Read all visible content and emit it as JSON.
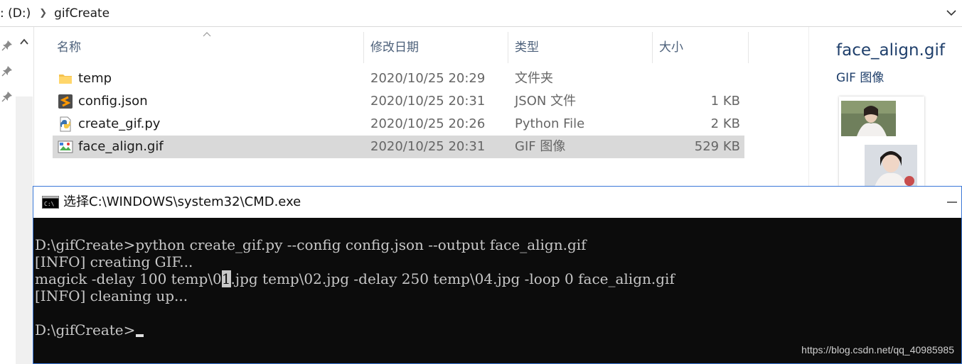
{
  "explorer": {
    "breadcrumb": [
      {
        "label": ": (D:)"
      },
      {
        "label": "gifCreate"
      }
    ],
    "columns": {
      "name": "名称",
      "date": "修改日期",
      "type": "类型",
      "size": "大小"
    },
    "files": [
      {
        "name": "temp",
        "date": "2020/10/25 20:29",
        "type": "文件夹",
        "size": "",
        "icon": "folder-icon"
      },
      {
        "name": "config.json",
        "date": "2020/10/25 20:31",
        "type": "JSON 文件",
        "size": "1 KB",
        "icon": "json-file-icon"
      },
      {
        "name": "create_gif.py",
        "date": "2020/10/25 20:26",
        "type": "Python File",
        "size": "2 KB",
        "icon": "python-file-icon"
      },
      {
        "name": "face_align.gif",
        "date": "2020/10/25 20:31",
        "type": "GIF 图像",
        "size": "529 KB",
        "icon": "image-file-icon",
        "selected": true
      }
    ],
    "preview": {
      "name": "face_align.gif",
      "type": "GIF 图像"
    }
  },
  "cmd": {
    "title": "选择C:\\WINDOWS\\system32\\CMD.exe",
    "lines": [
      "D:\\gifCreate>python create_gif.py --config config.json --output face_align.gif",
      "[INFO] creating GIF...",
      {
        "before": "magick -delay 100 temp\\0",
        "highlight": "1",
        "after": ".jpg temp\\02.jpg -delay 250 temp\\04.jpg -loop 0 face_align.gif"
      },
      "[INFO] cleaning up...",
      "",
      "D:\\gifCreate>"
    ]
  },
  "watermark": "https://blog.csdn.net/qq_40985985",
  "colors": {
    "selection": "#d9d9d9",
    "header_text": "#4c607a",
    "preview_text": "#1f3f6b",
    "console_bg": "#0c0c0c",
    "console_text": "#c8c8c8",
    "window_border": "#3b78d8"
  }
}
